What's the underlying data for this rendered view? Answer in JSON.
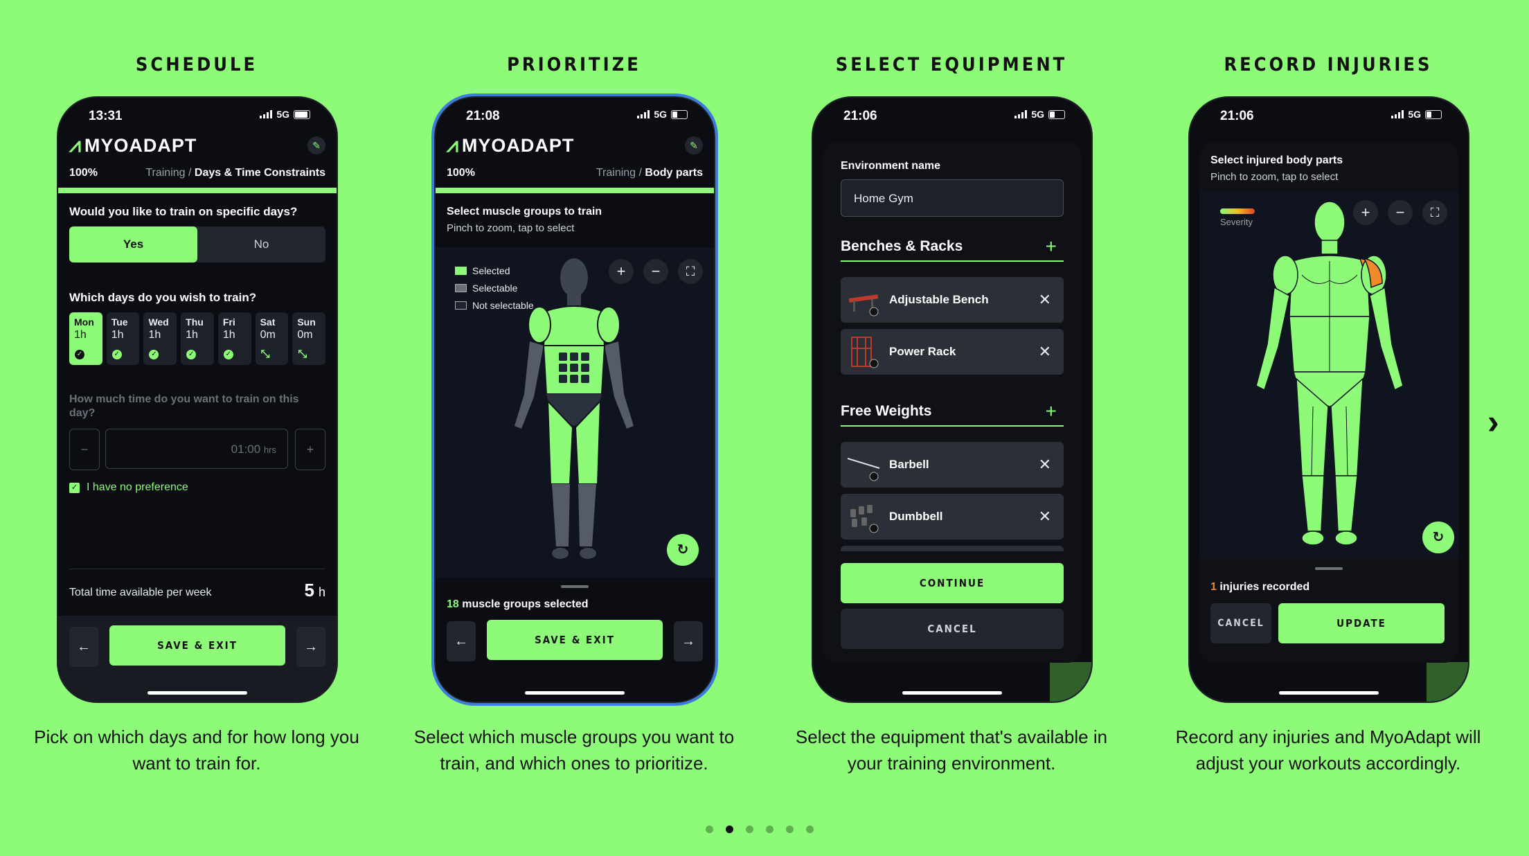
{
  "colors": {
    "background": "#8dfa78",
    "accent": "#8dfa78",
    "phone": "#0b0d12",
    "injury": "#f08a2a"
  },
  "panels": [
    {
      "title": "SCHEDULE",
      "caption": "Pick on which days and for how long you want to train for.",
      "status_time": "13:31",
      "network": "5G",
      "app_name": "MYOADAPT",
      "progress": "100%",
      "crumb_parent": "Training /",
      "crumb_current": "Days & Time Constraints",
      "q1": "Would you like to train on specific days?",
      "yes": "Yes",
      "no": "No",
      "q2": "Which days do you wish to train?",
      "days": [
        {
          "name": "Mon",
          "hours": "1h",
          "mark": "check"
        },
        {
          "name": "Tue",
          "hours": "1h",
          "mark": "check"
        },
        {
          "name": "Wed",
          "hours": "1h",
          "mark": "check"
        },
        {
          "name": "Thu",
          "hours": "1h",
          "mark": "check"
        },
        {
          "name": "Fri",
          "hours": "1h",
          "mark": "check"
        },
        {
          "name": "Sat",
          "hours": "0m",
          "mark": "expand"
        },
        {
          "name": "Sun",
          "hours": "0m",
          "mark": "expand"
        }
      ],
      "q3": "How much time do you want to train on this day?",
      "minus": "−",
      "plus": "+",
      "time_value": "01:00",
      "time_unit": "hrs",
      "no_pref": "I have no preference",
      "total_label": "Total time available per week",
      "total_value": "5",
      "total_unit": "h",
      "save_exit": "SAVE & EXIT"
    },
    {
      "title": "PRIORITIZE",
      "caption": "Select which muscle groups you want to train, and which ones to prioritize.",
      "status_time": "21:08",
      "network": "5G",
      "app_name": "MYOADAPT",
      "progress": "100%",
      "crumb_parent": "Training /",
      "crumb_current": "Body parts",
      "header": "Select muscle groups to train",
      "subheader": "Pinch to zoom, tap to select",
      "legend": [
        "Selected",
        "Selectable",
        "Not selectable"
      ],
      "count": "18",
      "count_label": "muscle groups selected",
      "save_exit": "SAVE & EXIT"
    },
    {
      "title": "SELECT EQUIPMENT",
      "caption": "Select the equipment that's available in your training environment.",
      "status_time": "21:06",
      "network": "5G",
      "env_label": "Environment name",
      "env_value": "Home Gym",
      "categories": [
        {
          "name": "Benches & Racks",
          "items": [
            "Adjustable Bench",
            "Power Rack"
          ]
        },
        {
          "name": "Free Weights",
          "items": [
            "Barbell",
            "Dumbbell"
          ]
        }
      ],
      "continue": "CONTINUE",
      "cancel": "CANCEL"
    },
    {
      "title": "RECORD INJURIES",
      "caption": "Record any injuries and MyoAdapt will adjust your workouts accordingly.",
      "status_time": "21:06",
      "network": "5G",
      "header": "Select injured body parts",
      "subheader": "Pinch to zoom, tap to select",
      "severity": "Severity",
      "count": "1",
      "count_label": "injuries recorded",
      "cancel": "CANCEL",
      "update": "UPDATE"
    }
  ],
  "pager": {
    "count": 6,
    "active": 1
  }
}
